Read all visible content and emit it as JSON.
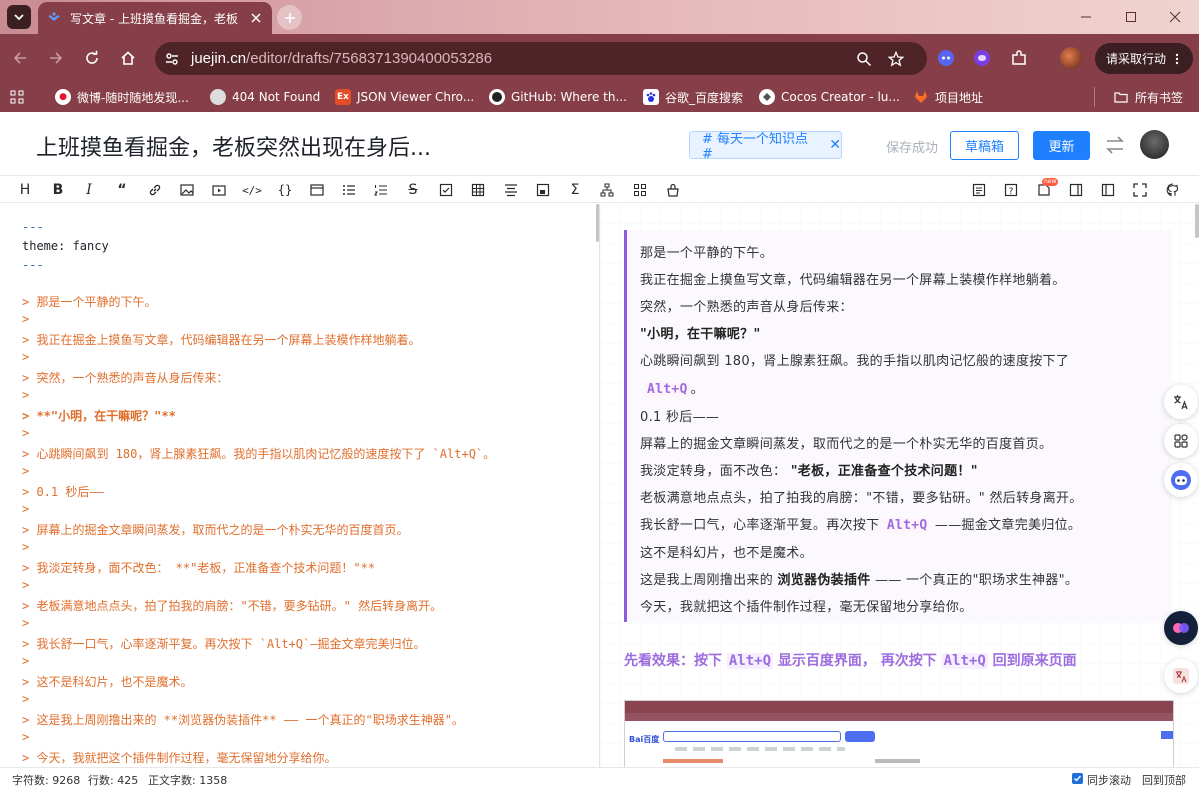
{
  "browser": {
    "tab_title": "写文章 - 上班摸鱼看掘金，老板",
    "url_host": "juejin.cn",
    "url_path": "/editor/drafts/7568371390400053286",
    "action_button": "请采取行动",
    "bookmarks": [
      {
        "label": "微博-随时随地发现...",
        "icon": "weibo-icon"
      },
      {
        "label": "404 Not Found",
        "icon": "globe-icon"
      },
      {
        "label": "JSON Viewer Chro...",
        "icon": "json-viewer-icon"
      },
      {
        "label": "GitHub: Where th...",
        "icon": "github-icon"
      },
      {
        "label": "谷歌_百度搜索",
        "icon": "baidu-icon"
      },
      {
        "label": "Cocos Creator - lu...",
        "icon": "cocos-icon"
      },
      {
        "label": "项目地址",
        "icon": "gitlab-icon"
      }
    ],
    "all_bookmarks": "所有书签"
  },
  "editor": {
    "title": "上班摸鱼看掘金，老板突然出现在身后...",
    "tag": "# 每天一个知识点 #",
    "save_state": "保存成功",
    "draft_button": "草稿箱",
    "update_button": "更新"
  },
  "markdown": {
    "frontmatter": [
      "---",
      "theme: fancy",
      "---"
    ],
    "theme_key": "theme:",
    "theme_value": " fancy",
    "lines": [
      "> 那是一个平静的下午。",
      ">",
      "> 我正在掘金上摸鱼写文章，代码编辑器在另一个屏幕上装模作样地躺着。",
      ">",
      "> 突然，一个熟悉的声音从身后传来：",
      ">",
      "> **\"小明，在干嘛呢？\"**",
      ">",
      "> 心跳瞬间飙到 180，肾上腺素狂飙。我的手指以肌肉记忆般的速度按下了 `Alt+Q`。",
      ">",
      "> 0.1 秒后——",
      ">",
      "> 屏幕上的掘金文章瞬间蒸发，取而代之的是一个朴实无华的百度首页。",
      ">",
      "> 我淡定转身，面不改色： **\"老板，正准备查个技术问题！\"**",
      ">",
      "> 老板满意地点点头，拍了拍我的肩膀：\"不错，要多钻研。\" 然后转身离开。",
      ">",
      "> 我长舒一口气，心率逐渐平复。再次按下 `Alt+Q`—掘金文章完美归位。",
      ">",
      "> 这不是科幻片，也不是魔术。",
      ">",
      "> 这是我上周刚撸出来的 **浏览器伪装插件** —— 一个真正的\"职场求生神器\"。",
      ">",
      "> 今天，我就把这个插件制作过程，毫无保留地分享给你。"
    ]
  },
  "preview": {
    "p1": "那是一个平静的下午。",
    "p2": "我正在掘金上摸鱼写文章，代码编辑器在另一个屏幕上装模作样地躺着。",
    "p3": "突然，一个熟悉的声音从身后传来：",
    "p4": "\"小明，在干嘛呢？\"",
    "p5": "心跳瞬间飙到 180，肾上腺素狂飙。我的手指以肌肉记忆般的速度按下了",
    "p6_code": "Alt+Q",
    "p6_tail": "。",
    "p7": "0.1 秒后——",
    "p8": "屏幕上的掘金文章瞬间蒸发，取而代之的是一个朴实无华的百度首页。",
    "p9_a": "我淡定转身，面不改色： ",
    "p9_b": "\"老板，正准备查个技术问题！\"",
    "p10": "老板满意地点点头，拍了拍我的肩膀：\"不错，要多钻研。\" 然后转身离开。",
    "p11_a": "我长舒一口气，心率逐渐平复。再次按下 ",
    "p11_code": "Alt+Q",
    "p11_b": " ——掘金文章完美归位。",
    "p12": "这不是科幻片，也不是魔术。",
    "p13_a": "这是我上周刚撸出来的 ",
    "p13_b": "浏览器伪装插件",
    "p13_c": " —— 一个真正的\"职场求生神器\"。",
    "p14": "今天，我就把这个插件制作过程，毫无保留地分享给你。",
    "h_a": "先看效果：按下 ",
    "h_k1": "Alt+Q",
    "h_b": " 显示百度界面， 再次按下 ",
    "h_k2": "Alt+Q",
    "h_c": " 回到原来页面"
  },
  "status": {
    "chars": "字符数: 9268",
    "lines": "行数: 425",
    "body_chars": "正文字数: 1358",
    "sync_scroll": "同步滚动",
    "back_top": "回到顶部"
  },
  "colors": {
    "browser_frame": "#863f48",
    "juejin_blue": "#1e80ff",
    "markdown_quote": "#e06f2e",
    "preview_accent": "#9c6ce0"
  }
}
